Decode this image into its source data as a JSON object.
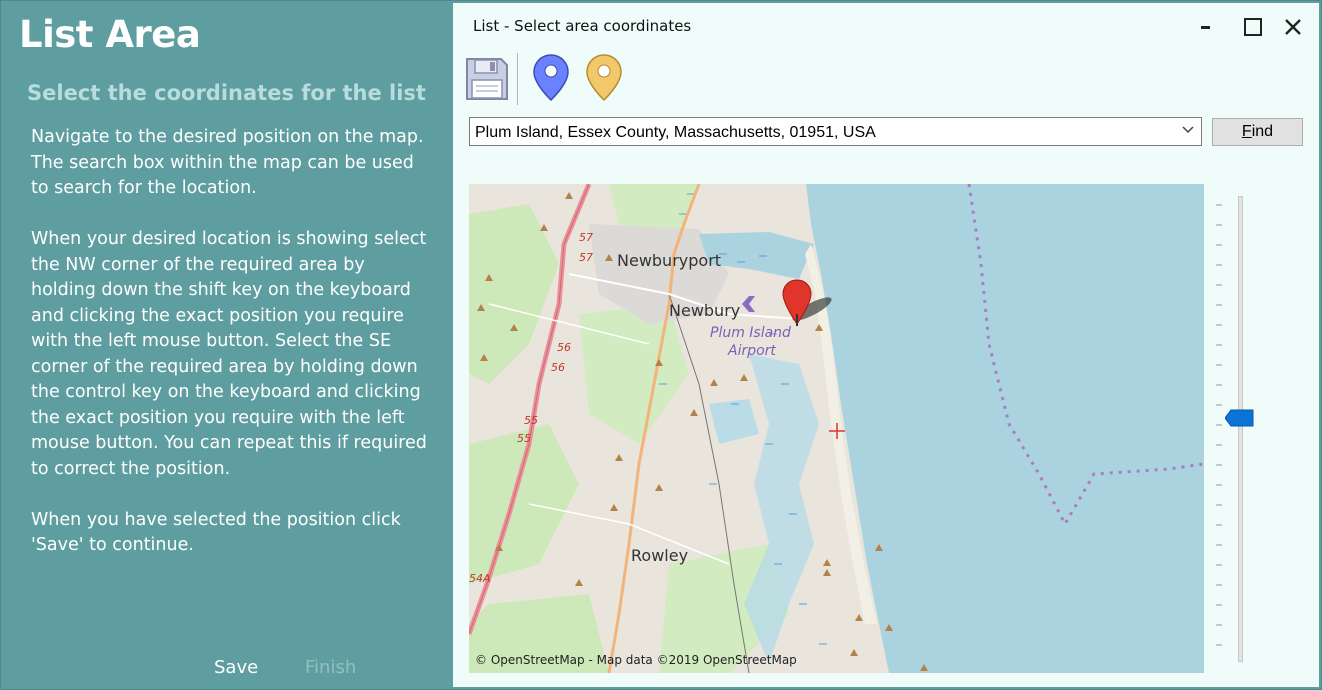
{
  "left_panel": {
    "title": "List Area",
    "subtitle": "Select the coordinates for the list",
    "paragraphs": [
      "Navigate to the desired position on the map. The search box within the map can be used to search for the location.",
      "When your desired location is showing select the NW corner of the required area by holding down the shift key on the keyboard and clicking the exact position you require with the left mouse button.  Select the SE corner of the required area by holding down the control key on the keyboard and clicking the exact position you require with the left mouse button. You can repeat this if required to correct the position.",
      "When you have selected the position click 'Save' to continue."
    ],
    "save_label": "Save",
    "finish_label": "Finish"
  },
  "dialog": {
    "title": "List - Select area coordinates",
    "window_controls": [
      "minimize-icon",
      "maximize-icon",
      "close-icon"
    ],
    "toolbar": [
      "save-disk-icon",
      "blue-map-pin-icon",
      "yellow-map-pin-icon"
    ],
    "search": {
      "value": "Plum Island, Essex County, Massachusetts, 01951, USA"
    },
    "find_label": "Find",
    "map": {
      "places": [
        "Newburyport",
        "Newbury",
        "Plum Island",
        "Airport",
        "Rowley"
      ],
      "route_shields": [
        "57",
        "57",
        "56",
        "56",
        "55",
        "55",
        "54A"
      ],
      "attribution": "© OpenStreetMap - Map data ©2019 OpenStreetMap",
      "marker": "red-map-pin-icon",
      "crosshair": "red-crosshair-icon"
    },
    "zoom_level": 0.5
  },
  "colors": {
    "panel_bg": "#5f9ea0",
    "subtitle": "#b9dcdd",
    "dialog_bg": "#f0fcfa",
    "water": "#aad3df",
    "land": "#e7e2d9",
    "marker": "#e0352b",
    "zoom_thumb": "#0a74d6"
  }
}
